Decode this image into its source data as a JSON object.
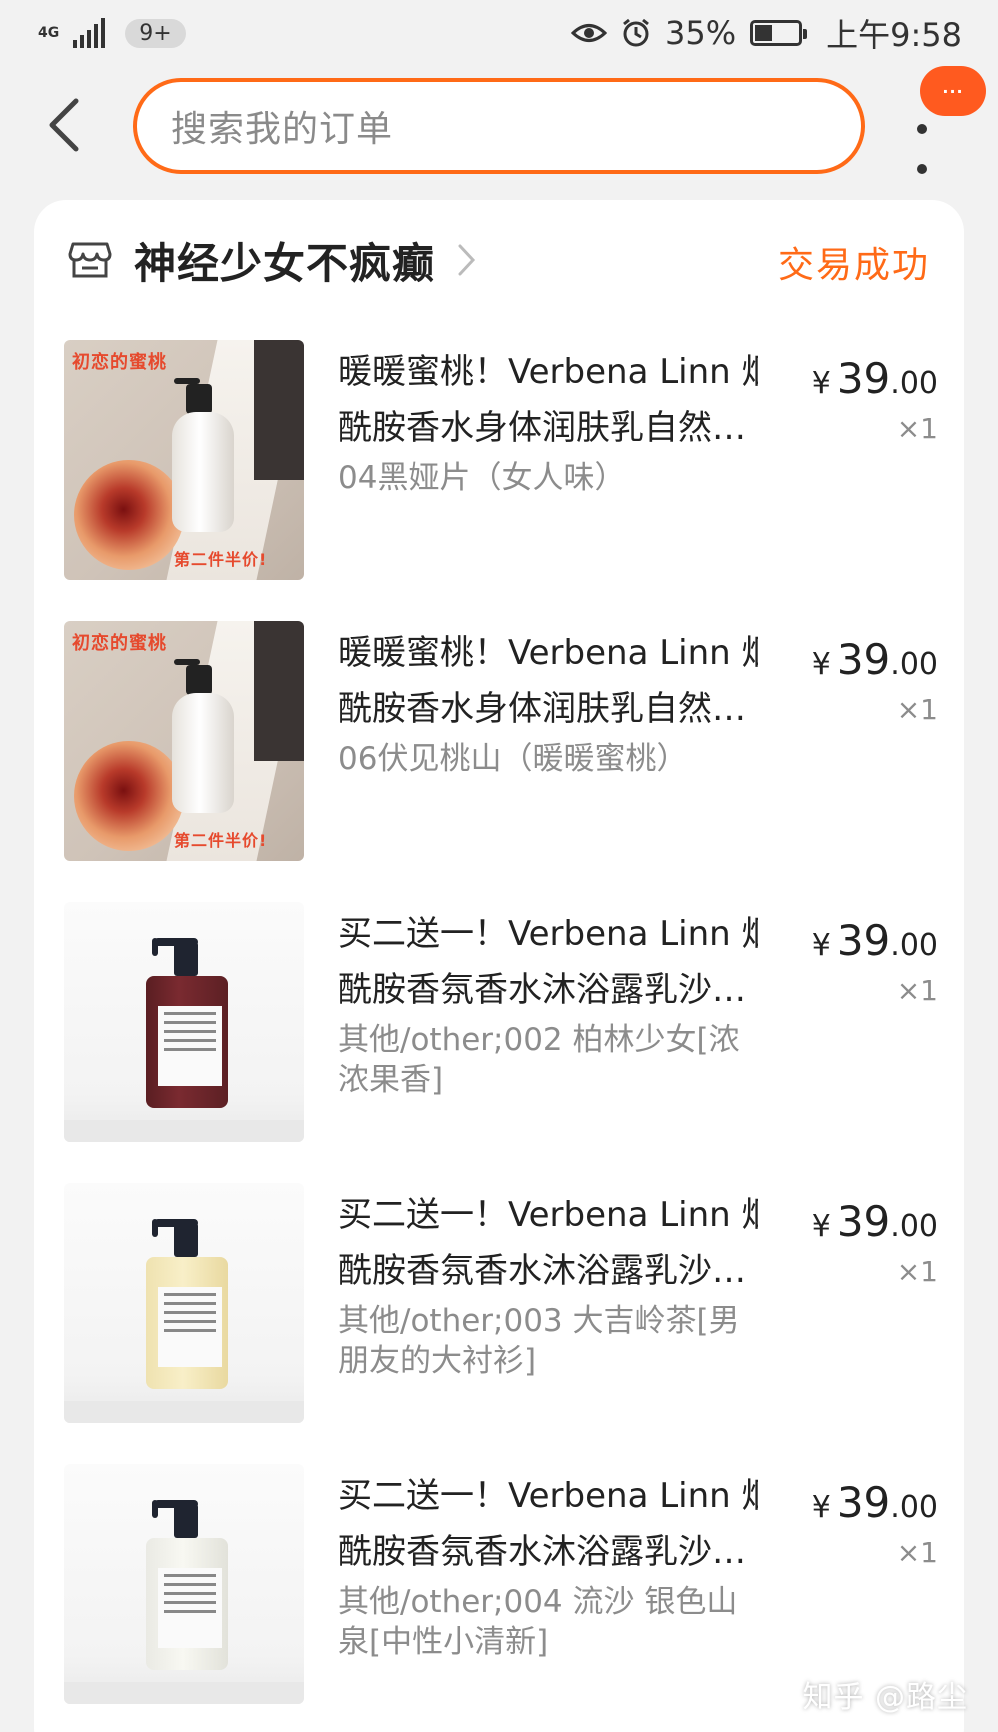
{
  "status_bar": {
    "network": "4G",
    "notification_count": "9+",
    "battery_percent": "35%",
    "time": "上午9:58"
  },
  "header": {
    "search_placeholder": "搜索我的订单",
    "more_badge": "···"
  },
  "order": {
    "shop_name": "神经少女不疯癫",
    "status": "交易成功",
    "items": [
      {
        "title_line1": "暖暖蜜桃！Verbena Linn 烟",
        "title_line2": "酰胺香水身体润肤乳自然…",
        "sku": "04黑娅片（女人味）",
        "price_yen": "¥",
        "price_int": "39",
        "price_dec": ".00",
        "qty": "×1",
        "image": "peach-lotion"
      },
      {
        "title_line1": "暖暖蜜桃！Verbena Linn 烟",
        "title_line2": "酰胺香水身体润肤乳自然…",
        "sku": "06伏见桃山（暖暖蜜桃）",
        "price_yen": "¥",
        "price_int": "39",
        "price_dec": ".00",
        "qty": "×1",
        "image": "peach-lotion"
      },
      {
        "title_line1": "买二送一！Verbena Linn 烟",
        "title_line2": "酰胺香氛香水沐浴露乳沙…",
        "sku": "其他/other;002 柏林少女[浓浓果香]",
        "price_yen": "¥",
        "price_int": "39",
        "price_dec": ".00",
        "qty": "×1",
        "image": "red-bottle"
      },
      {
        "title_line1": "买二送一！Verbena Linn 烟",
        "title_line2": "酰胺香氛香水沐浴露乳沙…",
        "sku": "其他/other;003 大吉岭茶[男朋友的大衬衫]",
        "price_yen": "¥",
        "price_int": "39",
        "price_dec": ".00",
        "qty": "×1",
        "image": "yellow-bottle"
      },
      {
        "title_line1": "买二送一！Verbena Linn 烟",
        "title_line2": "酰胺香氛香水沐浴露乳沙…",
        "sku": "其他/other;004 流沙 银色山泉[中性小清新]",
        "price_yen": "¥",
        "price_int": "39",
        "price_dec": ".00",
        "qty": "×1",
        "image": "clear-bottle"
      }
    ]
  },
  "watermark": "知乎 @路尘",
  "colors": {
    "accent": "#ff6a17",
    "background": "#f2f2f2",
    "sku_text": "#8c8c8c"
  },
  "image_overlay_text": {
    "top": "初恋的蜜桃",
    "bottom": "第二件半价!"
  }
}
